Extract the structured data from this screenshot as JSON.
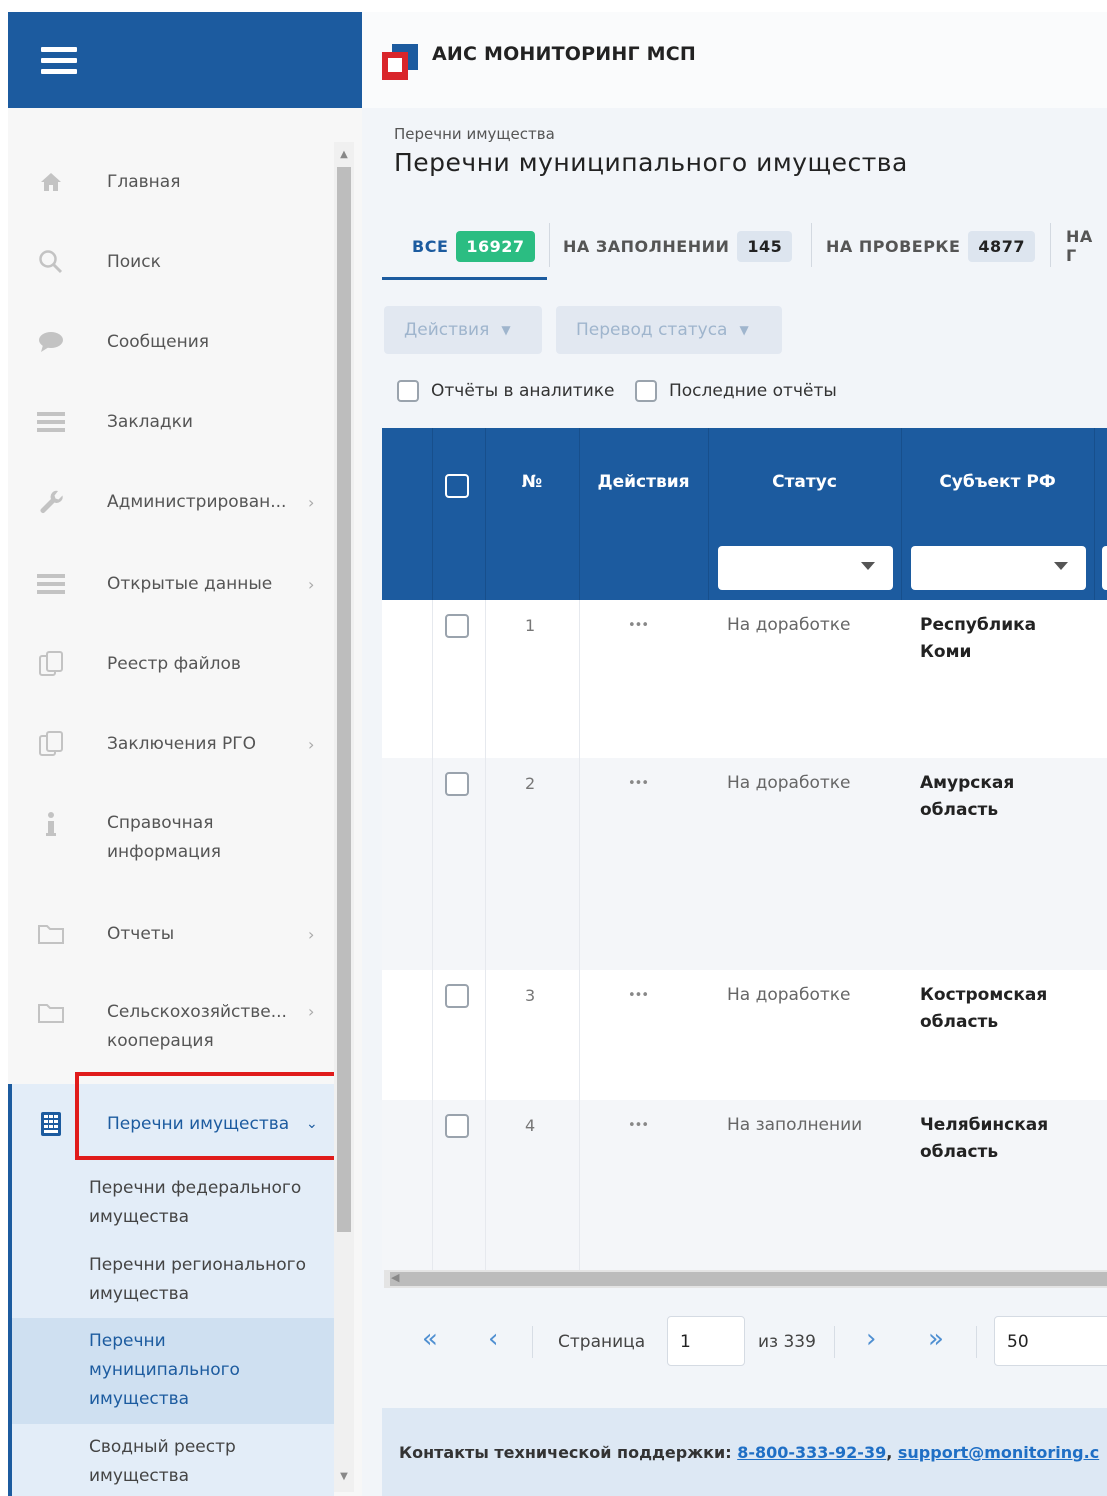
{
  "app": {
    "title": "АИС МОНИТОРИНГ МСП"
  },
  "sidebar": {
    "items": [
      {
        "label": "Главная",
        "icon": "home-icon"
      },
      {
        "label": "Поиск",
        "icon": "search-icon"
      },
      {
        "label": "Сообщения",
        "icon": "chat-icon"
      },
      {
        "label": "Закладки",
        "icon": "list-icon"
      },
      {
        "label": "Администрирован...",
        "icon": "wrench-icon"
      },
      {
        "label": "Открытые данные",
        "icon": "list-icon"
      },
      {
        "label": "Реестр файлов",
        "icon": "files-icon"
      },
      {
        "label": "Заключения РГО",
        "icon": "files-icon"
      },
      {
        "label": "Справочная\nинформация",
        "icon": "info-icon"
      },
      {
        "label": "Отчеты",
        "icon": "folder-icon"
      },
      {
        "label": "Сельскохозяйстве...\nкооперация",
        "icon": "folder-icon"
      },
      {
        "label": "Перечни имущества",
        "icon": "building-icon"
      }
    ],
    "sub_items": [
      "Перечни федерального\nимущества",
      "Перечни регионального\nимущества",
      "Перечни\nмуниципального\nимущества",
      "Сводный реестр\nимущества"
    ]
  },
  "breadcrumb": "Перечни имущества",
  "page_title": "Перечни муниципального имущества",
  "tabs": [
    {
      "label": "ВСЕ",
      "count": "16927"
    },
    {
      "label": "НА ЗАПОЛНЕНИИ",
      "count": "145"
    },
    {
      "label": "НА ПРОВЕРКЕ",
      "count": "4877"
    },
    {
      "label": "НА Г"
    }
  ],
  "toolbar": {
    "actions_label": "Действия",
    "status_label": "Перевод статуса"
  },
  "filters": {
    "analytics_label": "Отчёты в аналитике",
    "latest_label": "Последние отчёты"
  },
  "table": {
    "headers": {
      "num": "№",
      "actions": "Действия",
      "status": "Статус",
      "region": "Субъект РФ"
    },
    "actions_glyph": "•••",
    "rows": [
      {
        "num": "1",
        "status": "На доработке",
        "region": "Республика\nКоми"
      },
      {
        "num": "2",
        "status": "На доработке",
        "region": "Амурская\nобласть"
      },
      {
        "num": "3",
        "status": "На доработке",
        "region": "Костромская\nобласть"
      },
      {
        "num": "4",
        "status": "На заполнении",
        "region": "Челябинская\nобласть"
      }
    ]
  },
  "pager": {
    "page_label": "Страница",
    "page_value": "1",
    "of_label": "из 339",
    "page_size": "50"
  },
  "footer": {
    "label": "Контакты технической поддержки: ",
    "phone": "8-800-333-92-39",
    "separator": ", ",
    "email": "support@monitoring.c"
  },
  "colors": {
    "brand_blue": "#1c5b9f",
    "badge_green": "#2bbd82",
    "highlight_red": "#e01b1b"
  }
}
